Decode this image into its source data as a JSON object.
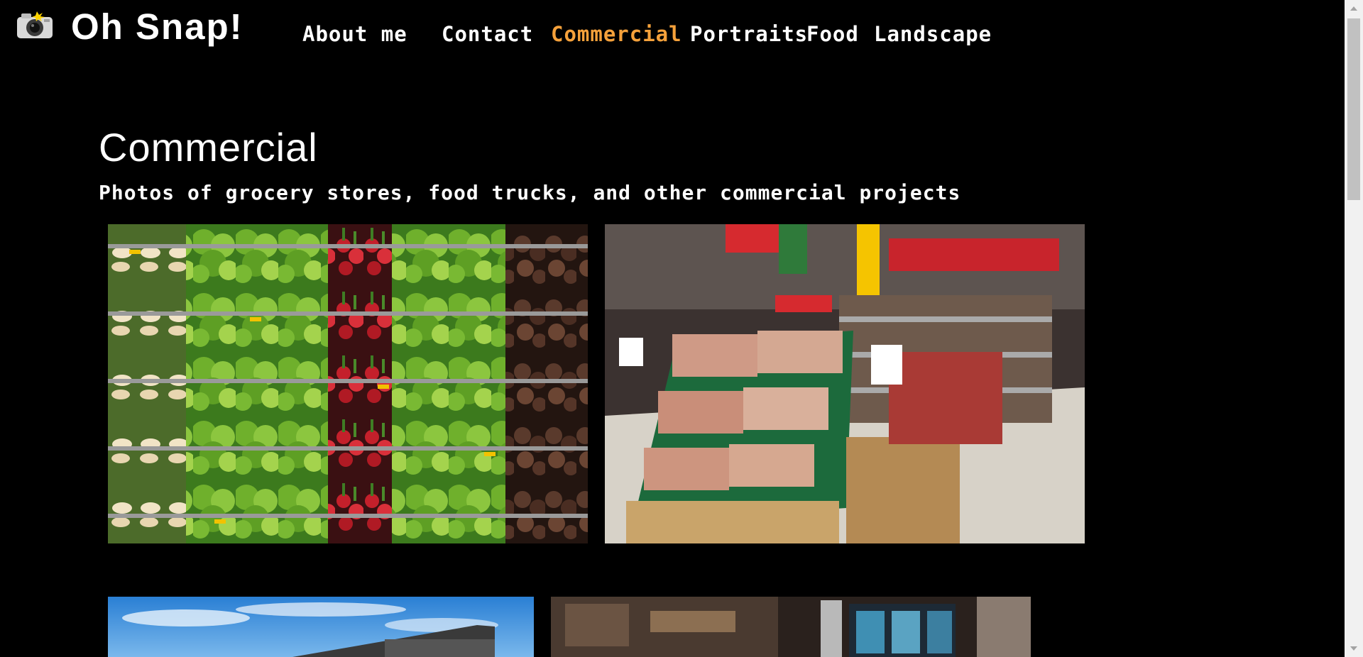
{
  "brand": {
    "name": "Oh Snap!",
    "logo_icon": "camera-icon"
  },
  "nav": {
    "items": [
      {
        "label": "About me",
        "active": false
      },
      {
        "label": "Contact",
        "active": false
      },
      {
        "label": "Commercial",
        "active": true
      },
      {
        "label": "Portraits",
        "active": false
      },
      {
        "label": "Food",
        "active": false
      },
      {
        "label": "Landscape",
        "active": false
      }
    ]
  },
  "page": {
    "title": "Commercial",
    "subtitle": "Photos of grocery stores, food trucks, and other commercial projects"
  },
  "gallery": {
    "photos": [
      {
        "subject": "produce-shelves"
      },
      {
        "subject": "supermarket-aisle"
      },
      {
        "subject": "building-sky"
      },
      {
        "subject": "store-interior"
      }
    ]
  },
  "colors": {
    "background": "#000000",
    "text": "#ffffff",
    "accent": "#f5a13b"
  }
}
